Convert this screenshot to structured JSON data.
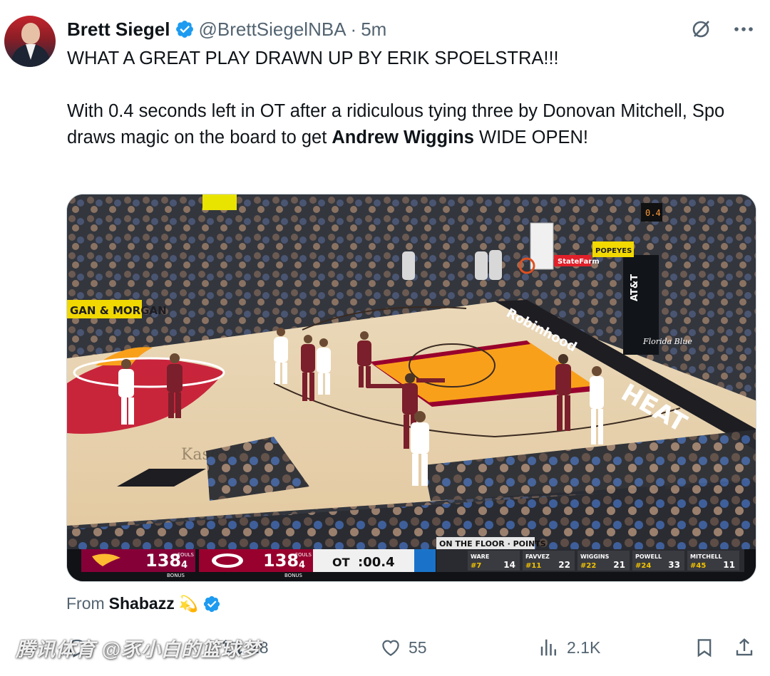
{
  "author": {
    "name": "Brett Siegel",
    "handle": "@BrettSiegelNBA",
    "separator": "·",
    "time": "5m"
  },
  "tweet": {
    "line1": "WHAT A GREAT PLAY DRAWN UP BY ERIK SPOELSTRA!!!",
    "line2_pre": "With 0.4 seconds left in OT after a ridiculous tying three by Donovan Mitchell, Spo draws magic on the board to get ",
    "line2_bold": "Andrew Wiggins",
    "line2_post": " WIDE OPEN!"
  },
  "video": {
    "signage": {
      "gan_morgan": "GAN & MORGAN",
      "att": "AT&T",
      "florida_blue": "Florida Blue",
      "heat": "HEAT",
      "statefarm": "StateFarm",
      "goodyear": "Robinhood",
      "shot_clock": "0.4",
      "top_ad": "POPEYES",
      "kaseya": "Kaseya"
    },
    "scoreboard": {
      "away_score": "138",
      "away_fouls_label": "FOULS",
      "away_fouls": "4",
      "away_bonus": "BONUS",
      "home_score": "138",
      "home_fouls_label": "FOULS",
      "home_fouls": "4",
      "home_bonus": "BONUS",
      "period": "OT",
      "clock": ":00.4",
      "on_floor_label": "ON THE FLOOR · POINTS",
      "players": [
        {
          "name": "WARE",
          "number": "#7",
          "points": "14"
        },
        {
          "name": "FAVVEZ",
          "number": "#11",
          "points": "22"
        },
        {
          "name": "WIGGINS",
          "number": "#22",
          "points": "21"
        },
        {
          "name": "POWELL",
          "number": "#24",
          "points": "33"
        },
        {
          "name": "MITCHELL",
          "number": "#45",
          "points": "11"
        }
      ]
    }
  },
  "from": {
    "label": "From",
    "source": "Shabazz",
    "emoji": "💫"
  },
  "actions": {
    "reply_count": "",
    "repost_count": "18",
    "like_count": "55",
    "views_count": "2.1K"
  },
  "watermark": "腾讯体育 @豕小白的篮球梦",
  "colors": {
    "verified": "#1d9bf0",
    "text": "#0f1419",
    "muted": "#536471",
    "heat_red": "#98002e",
    "court_wood": "#e8d3b0",
    "paint_yellow": "#f9a01b"
  }
}
